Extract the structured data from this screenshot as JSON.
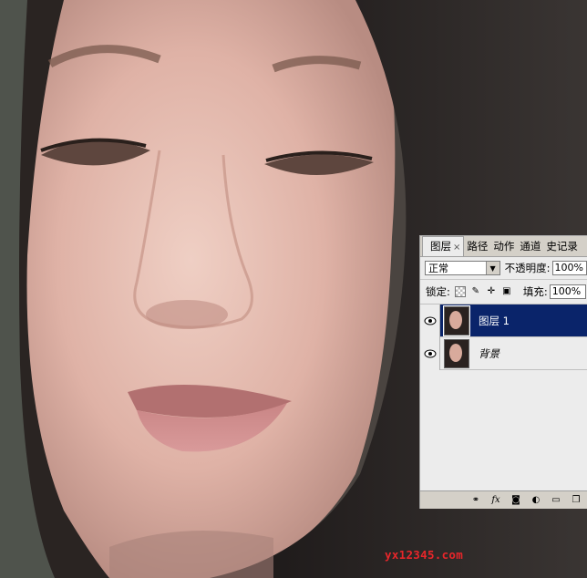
{
  "panel": {
    "tabs": [
      {
        "label": "图层",
        "active": true
      },
      {
        "label": "路径"
      },
      {
        "label": "动作"
      },
      {
        "label": "通道"
      },
      {
        "label": "史记录"
      }
    ],
    "tab_close": "×",
    "blend_mode": "正常",
    "opacity_label": "不透明度:",
    "opacity_value": "100%",
    "lock_label": "锁定:",
    "fill_label": "填充:",
    "fill_value": "100%",
    "layers": [
      {
        "name": "图层 1",
        "selected": true,
        "visible": true
      },
      {
        "name": "背景",
        "selected": false,
        "visible": true,
        "italic": true
      }
    ],
    "bottom_icons": [
      "link-icon",
      "fx-icon",
      "mask-icon",
      "adjustment-icon",
      "folder-icon",
      "new-layer-icon"
    ],
    "fx_label": "fx"
  },
  "watermark": "yx12345.com",
  "colors": {
    "selection": "#0a246a",
    "watermark": "#e8262a"
  }
}
